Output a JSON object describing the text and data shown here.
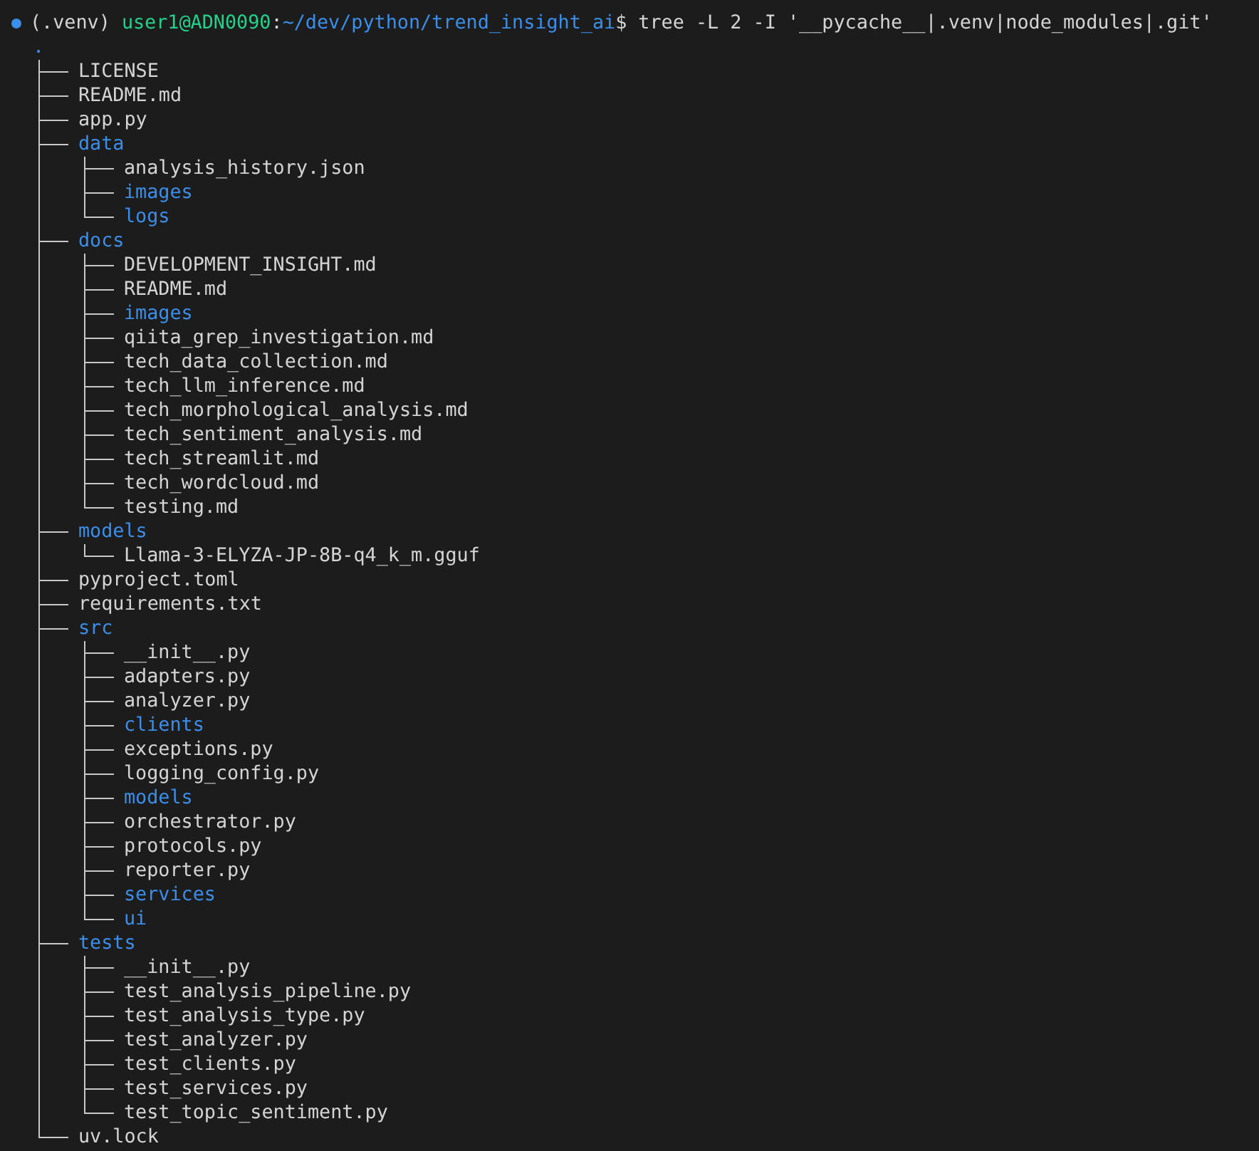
{
  "prompt": {
    "venv": "(.venv)",
    "user_host": "user1@ADN0090",
    "separator": ":",
    "path": "~/dev/python/trend_insight_ai",
    "symbol": "$",
    "command": "tree -L 2 -I '__pycache__|.venv|node_modules|.git'"
  },
  "tree": {
    "root": ".",
    "children": [
      {
        "name": "LICENSE",
        "kind": "file"
      },
      {
        "name": "README.md",
        "kind": "file"
      },
      {
        "name": "app.py",
        "kind": "file"
      },
      {
        "name": "data",
        "kind": "dir",
        "children": [
          {
            "name": "analysis_history.json",
            "kind": "file"
          },
          {
            "name": "images",
            "kind": "dir"
          },
          {
            "name": "logs",
            "kind": "dir"
          }
        ]
      },
      {
        "name": "docs",
        "kind": "dir",
        "children": [
          {
            "name": "DEVELOPMENT_INSIGHT.md",
            "kind": "file"
          },
          {
            "name": "README.md",
            "kind": "file"
          },
          {
            "name": "images",
            "kind": "dir"
          },
          {
            "name": "qiita_grep_investigation.md",
            "kind": "file"
          },
          {
            "name": "tech_data_collection.md",
            "kind": "file"
          },
          {
            "name": "tech_llm_inference.md",
            "kind": "file"
          },
          {
            "name": "tech_morphological_analysis.md",
            "kind": "file"
          },
          {
            "name": "tech_sentiment_analysis.md",
            "kind": "file"
          },
          {
            "name": "tech_streamlit.md",
            "kind": "file"
          },
          {
            "name": "tech_wordcloud.md",
            "kind": "file"
          },
          {
            "name": "testing.md",
            "kind": "file"
          }
        ]
      },
      {
        "name": "models",
        "kind": "dir",
        "children": [
          {
            "name": "Llama-3-ELYZA-JP-8B-q4_k_m.gguf",
            "kind": "file"
          }
        ]
      },
      {
        "name": "pyproject.toml",
        "kind": "file"
      },
      {
        "name": "requirements.txt",
        "kind": "file"
      },
      {
        "name": "src",
        "kind": "dir",
        "children": [
          {
            "name": "__init__.py",
            "kind": "file"
          },
          {
            "name": "adapters.py",
            "kind": "file"
          },
          {
            "name": "analyzer.py",
            "kind": "file"
          },
          {
            "name": "clients",
            "kind": "dir"
          },
          {
            "name": "exceptions.py",
            "kind": "file"
          },
          {
            "name": "logging_config.py",
            "kind": "file"
          },
          {
            "name": "models",
            "kind": "dir"
          },
          {
            "name": "orchestrator.py",
            "kind": "file"
          },
          {
            "name": "protocols.py",
            "kind": "file"
          },
          {
            "name": "reporter.py",
            "kind": "file"
          },
          {
            "name": "services",
            "kind": "dir"
          },
          {
            "name": "ui",
            "kind": "dir"
          }
        ]
      },
      {
        "name": "tests",
        "kind": "dir",
        "children": [
          {
            "name": "__init__.py",
            "kind": "file"
          },
          {
            "name": "test_analysis_pipeline.py",
            "kind": "file"
          },
          {
            "name": "test_analysis_type.py",
            "kind": "file"
          },
          {
            "name": "test_analyzer.py",
            "kind": "file"
          },
          {
            "name": "test_clients.py",
            "kind": "file"
          },
          {
            "name": "test_services.py",
            "kind": "file"
          },
          {
            "name": "test_topic_sentiment.py",
            "kind": "file"
          }
        ]
      },
      {
        "name": "uv.lock",
        "kind": "file"
      }
    ]
  }
}
